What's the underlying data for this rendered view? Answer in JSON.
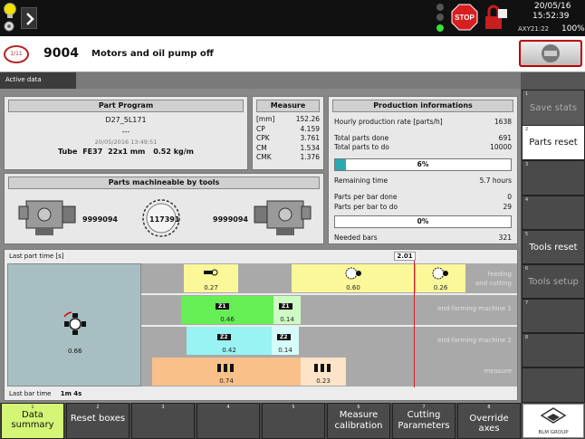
{
  "status": {
    "date": "20/05/16",
    "time": "15:52:39",
    "axis": "AXY21:22",
    "battery": "100%",
    "stop_label": "STOP"
  },
  "message": {
    "badge": "1/11",
    "code": "9004",
    "text": "Motors and oil pump off"
  },
  "tabs": {
    "active": "Active data"
  },
  "part_program": {
    "header": "Part Program",
    "name": "D27_5L171",
    "dashes": "---",
    "timestamp": "20/05/2016 13:49:51",
    "tube_label": "Tube",
    "tube_code": "FE37",
    "tube_size": "22x1 mm",
    "tube_weight": "0.52 kg/m"
  },
  "measure": {
    "header": "Measure",
    "rows": [
      {
        "label": "[mm]",
        "value": "152.26"
      },
      {
        "label": "CP",
        "value": "4.159"
      },
      {
        "label": "CPK",
        "value": "3.761"
      },
      {
        "label": "CM",
        "value": "1.534"
      },
      {
        "label": "CMK",
        "value": "1.376"
      }
    ]
  },
  "parts_machineable": {
    "header": "Parts machineable by tools",
    "left": "9999094",
    "center": "117391",
    "right": "9999094"
  },
  "production": {
    "header": "Production informations",
    "hourly_label": "Hourly production rate [parts/h]",
    "hourly_value": "1638",
    "done_label": "Total parts done",
    "done_value": "691",
    "todo_label": "Total parts to do",
    "todo_value": "10000",
    "progress1": "6%",
    "progress1_fraction": 0.06,
    "remaining_label": "Remaining time",
    "remaining_value": "5.7 hours",
    "perbar_done_label": "Parts per bar done",
    "perbar_done_value": "0",
    "perbar_todo_label": "Parts per bar to do",
    "perbar_todo_value": "29",
    "progress2": "0%",
    "progress2_fraction": 0.0,
    "needed_label": "Needed bars",
    "needed_value": "321"
  },
  "timeline": {
    "last_part_label": "Last part time [s]",
    "last_part_value": "2.01",
    "last_bar_label": "Last bar time",
    "last_bar_value": "1m 4s",
    "loader_value": "0.66",
    "lanes": [
      {
        "label": "feeding and cutting",
        "label1": "feeding",
        "label2": "and cutting"
      },
      {
        "label": "end-forming machine 1"
      },
      {
        "label": "end-forming machine 2"
      },
      {
        "label": "measure"
      }
    ],
    "blocks": {
      "feed1": "0.27",
      "feed2": "0.60",
      "feed3": "0.26",
      "z1a": "0.46",
      "z1b": "0.14",
      "z1_tag": "Z1",
      "z2a": "0.42",
      "z2b": "0.14",
      "z2_tag": "Z2",
      "m1": "0.74",
      "m2": "0.23"
    }
  },
  "right_buttons": [
    {
      "num": "1",
      "label": "Save stats",
      "enabled": false
    },
    {
      "num": "2",
      "label": "Parts reset",
      "enabled": true
    },
    {
      "num": "3",
      "label": "",
      "enabled": false
    },
    {
      "num": "4",
      "label": "",
      "enabled": false
    },
    {
      "num": "5",
      "label": "Tools reset",
      "enabled": true
    },
    {
      "num": "6",
      "label": "Tools setup",
      "enabled": false
    },
    {
      "num": "7",
      "label": "",
      "enabled": false
    },
    {
      "num": "8",
      "label": "",
      "enabled": false
    }
  ],
  "bottom_buttons": [
    {
      "num": "1",
      "label": "Data summary"
    },
    {
      "num": "2",
      "label": "Reset boxes"
    },
    {
      "num": "3",
      "label": ""
    },
    {
      "num": "4",
      "label": ""
    },
    {
      "num": "5",
      "label": ""
    },
    {
      "num": "6",
      "label": "Measure calibration"
    },
    {
      "num": "7",
      "label": "Cutting Parameters"
    },
    {
      "num": "8",
      "label": "Override axes"
    }
  ],
  "logo": {
    "text": "BLM GROUP"
  },
  "colors": {
    "yellow": "#fbf89a",
    "green": "#66ee55",
    "cyan": "#99f3f3",
    "orange": "#f9c08a",
    "active": "#d4f576",
    "progress": "#2aa9b0"
  }
}
